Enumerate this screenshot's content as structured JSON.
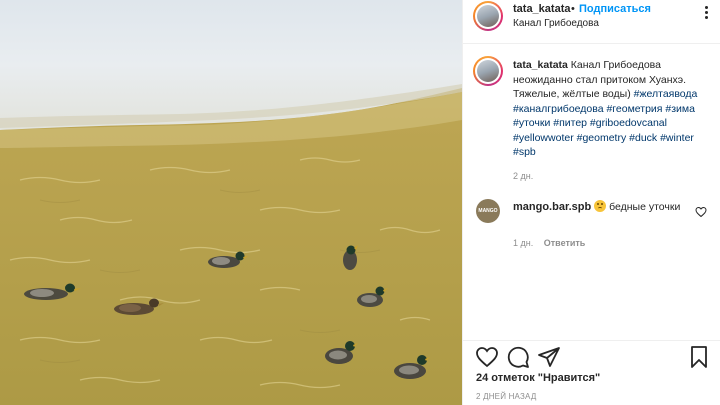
{
  "header": {
    "username": "tata_katata",
    "separator": "•",
    "follow_label": "Подписаться",
    "location": "Канал Грибоедова",
    "more_icon": "more-dots-icon"
  },
  "caption": {
    "username": "tata_katata",
    "text": "Канал Грибоедова неожиданно стал притоком Хуанхэ. Тяжелые, жёлтые воды)",
    "hashtags": "#желтаявода #каналгрибоедова #геометрия #зима #уточки #питер #griboedovcanal #yellowwoter #geometry #duck #winter #spb",
    "time": "2 дн."
  },
  "comment": {
    "avatar_text": "MANGO",
    "username": "mango.bar.spb",
    "emoji_icon": "sad-face-emoji-icon",
    "text": "бедные уточки",
    "time": "1 дн.",
    "reply_label": "Ответить"
  },
  "actions": {
    "icons": [
      "heart-icon",
      "comment-icon",
      "share-icon",
      "bookmark-icon"
    ],
    "likes_text": "24 отметок \"Нравится\"",
    "time_ago": "2 ДНЕЙ НАЗАД"
  },
  "colors": {
    "accent": "#0095f6",
    "hashtag": "#00376b",
    "muted": "#8e8e8e",
    "water": "#b8a253",
    "ice": "#e6ebee"
  }
}
